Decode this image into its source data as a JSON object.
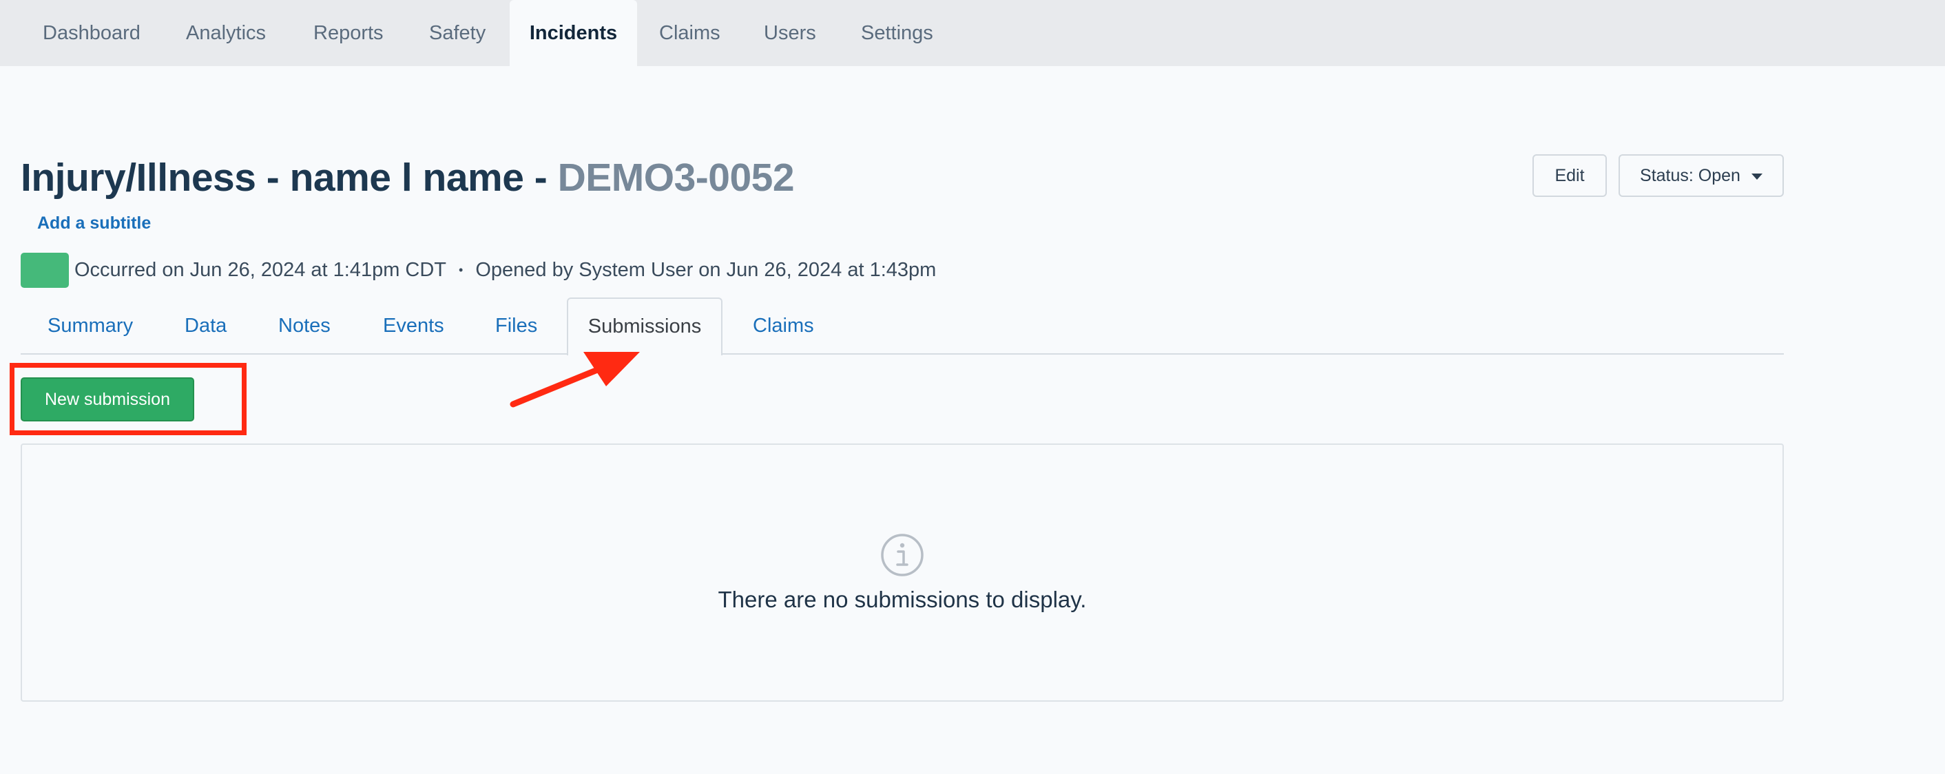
{
  "top_nav": {
    "items": [
      "Dashboard",
      "Analytics",
      "Reports",
      "Safety",
      "Incidents",
      "Claims",
      "Users",
      "Settings"
    ],
    "active": "Incidents"
  },
  "header": {
    "title_main": "Injury/Illness - name l name - ",
    "record_id": "DEMO3-0052",
    "subtitle_link": "Add a subtitle",
    "occurred": "Occurred on Jun 26, 2024 at 1:41pm CDT",
    "separator": "•",
    "opened": "Opened by System User on Jun 26, 2024 at 1:43pm",
    "edit_label": "Edit",
    "status_label": "Status: Open"
  },
  "tabs": {
    "items": [
      "Summary",
      "Data",
      "Notes",
      "Events",
      "Files",
      "Submissions",
      "Claims"
    ],
    "active": "Submissions"
  },
  "actions": {
    "new_submission_label": "New submission"
  },
  "empty_state": {
    "icon": "info-circle-icon",
    "message": "There are no submissions to display."
  },
  "colors": {
    "severity_swatch": "#45b97a",
    "primary_green": "#2eaa64",
    "link_blue": "#1a6fba",
    "annotation_red": "#ff2a12"
  }
}
